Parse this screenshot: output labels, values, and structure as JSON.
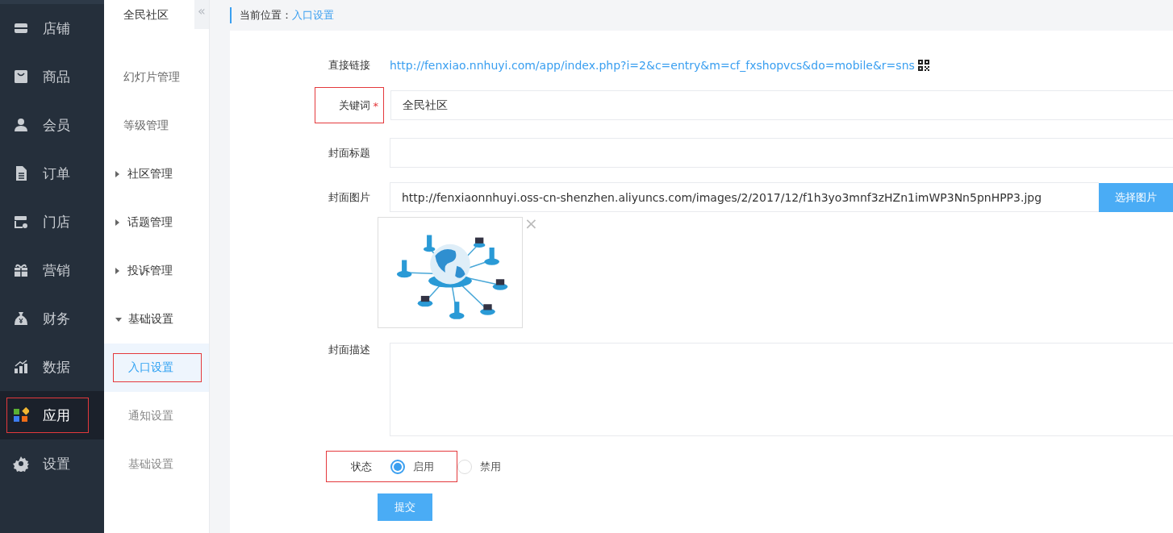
{
  "main_nav": {
    "items": [
      {
        "label": "店铺",
        "selected": false,
        "highlighted": false
      },
      {
        "label": "商品",
        "selected": false,
        "highlighted": false
      },
      {
        "label": "会员",
        "selected": false,
        "highlighted": false
      },
      {
        "label": "订单",
        "selected": false,
        "highlighted": false
      },
      {
        "label": "门店",
        "selected": false,
        "highlighted": false
      },
      {
        "label": "营销",
        "selected": false,
        "highlighted": false
      },
      {
        "label": "财务",
        "selected": false,
        "highlighted": false
      },
      {
        "label": "数据",
        "selected": false,
        "highlighted": false
      },
      {
        "label": "应用",
        "selected": true,
        "highlighted": true
      },
      {
        "label": "设置",
        "selected": false,
        "highlighted": false
      }
    ]
  },
  "sub_nav": {
    "title": "全民社区",
    "collapse_glyph": "«",
    "items": [
      {
        "kind": "leaf",
        "label": "幻灯片管理",
        "selected": false,
        "highlighted": false
      },
      {
        "kind": "leaf",
        "label": "等级管理",
        "selected": false,
        "highlighted": false
      },
      {
        "kind": "group",
        "label": "社区管理",
        "expanded": false
      },
      {
        "kind": "group",
        "label": "话题管理",
        "expanded": false
      },
      {
        "kind": "group",
        "label": "投诉管理",
        "expanded": false
      },
      {
        "kind": "group",
        "label": "基础设置",
        "expanded": true,
        "children": [
          {
            "kind": "leaf",
            "label": "入口设置",
            "selected": true,
            "highlighted": true
          },
          {
            "kind": "leaf",
            "label": "通知设置",
            "selected": false,
            "highlighted": false
          },
          {
            "kind": "leaf",
            "label": "基础设置",
            "selected": false,
            "highlighted": false
          }
        ]
      }
    ]
  },
  "breadcrumb": {
    "label": "当前位置：",
    "current": "入口设置"
  },
  "form": {
    "link": {
      "label": "直接链接",
      "url": "http://fenxiao.nnhuyi.com/app/index.php?i=2&c=entry&m=cf_fxshopvcs&do=mobile&r=sns"
    },
    "keyword": {
      "label": "关键词",
      "required_mark": "*",
      "value": "全民社区",
      "highlighted": true
    },
    "cover_title": {
      "label": "封面标题"
    },
    "cover_image": {
      "label": "封面图片",
      "value": "http://fenxiaonnhuyi.oss-cn-shenzhen.aliyuncs.com/images/2/2017/12/f1h3yo3mnf3zHZn1imWP3Nn5pnHPP3.jpg",
      "button": "选择图片",
      "remove_glyph": "×"
    },
    "cover_description": {
      "label": "封面描述"
    },
    "status": {
      "label": "状态",
      "highlighted": true,
      "options": [
        {
          "label": "启用",
          "selected": true
        },
        {
          "label": "禁用",
          "selected": false
        }
      ]
    },
    "submit": "提交"
  }
}
